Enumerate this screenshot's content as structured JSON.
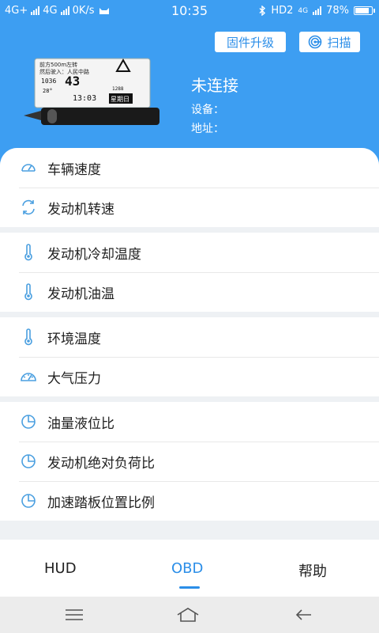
{
  "status_bar": {
    "network_1": "4G+",
    "network_2": "4G",
    "speed": "0K/s",
    "time": "10:35",
    "hd": "HD2",
    "lte": "4G",
    "battery": "78%"
  },
  "header": {
    "firmware_button": "固件升级",
    "scan_button": "扫描",
    "connection_status": "未连接",
    "device_label": "设备：",
    "address_label": "地址："
  },
  "device_screen": {
    "nav_line1": "前方500m左转",
    "nav_line2": "然后驶入：人民中路",
    "speed": "43",
    "rpm": "1036",
    "temp": "28°",
    "time": "13:03",
    "weekday": "星期日",
    "distance": "1288"
  },
  "list_groups": [
    [
      {
        "label": "车辆速度",
        "icon": "speedometer-icon"
      },
      {
        "label": "发动机转速",
        "icon": "rotate-icon"
      }
    ],
    [
      {
        "label": "发动机冷却温度",
        "icon": "thermometer-icon"
      },
      {
        "label": "发动机油温",
        "icon": "thermometer-icon"
      }
    ],
    [
      {
        "label": "环境温度",
        "icon": "thermometer-icon"
      },
      {
        "label": "大气压力",
        "icon": "gauge-icon"
      }
    ],
    [
      {
        "label": "油量液位比",
        "icon": "pie-chart-icon"
      },
      {
        "label": "发动机绝对负荷比",
        "icon": "pie-chart-icon"
      },
      {
        "label": "加速踏板位置比例",
        "icon": "pie-chart-icon"
      }
    ]
  ],
  "tabs": [
    {
      "label": "HUD",
      "active": false
    },
    {
      "label": "OBD",
      "active": true
    },
    {
      "label": "帮助",
      "active": false
    }
  ],
  "colors": {
    "primary": "#3d9ef2",
    "accent": "#2b8ee8",
    "icon": "#4a9fe0"
  }
}
